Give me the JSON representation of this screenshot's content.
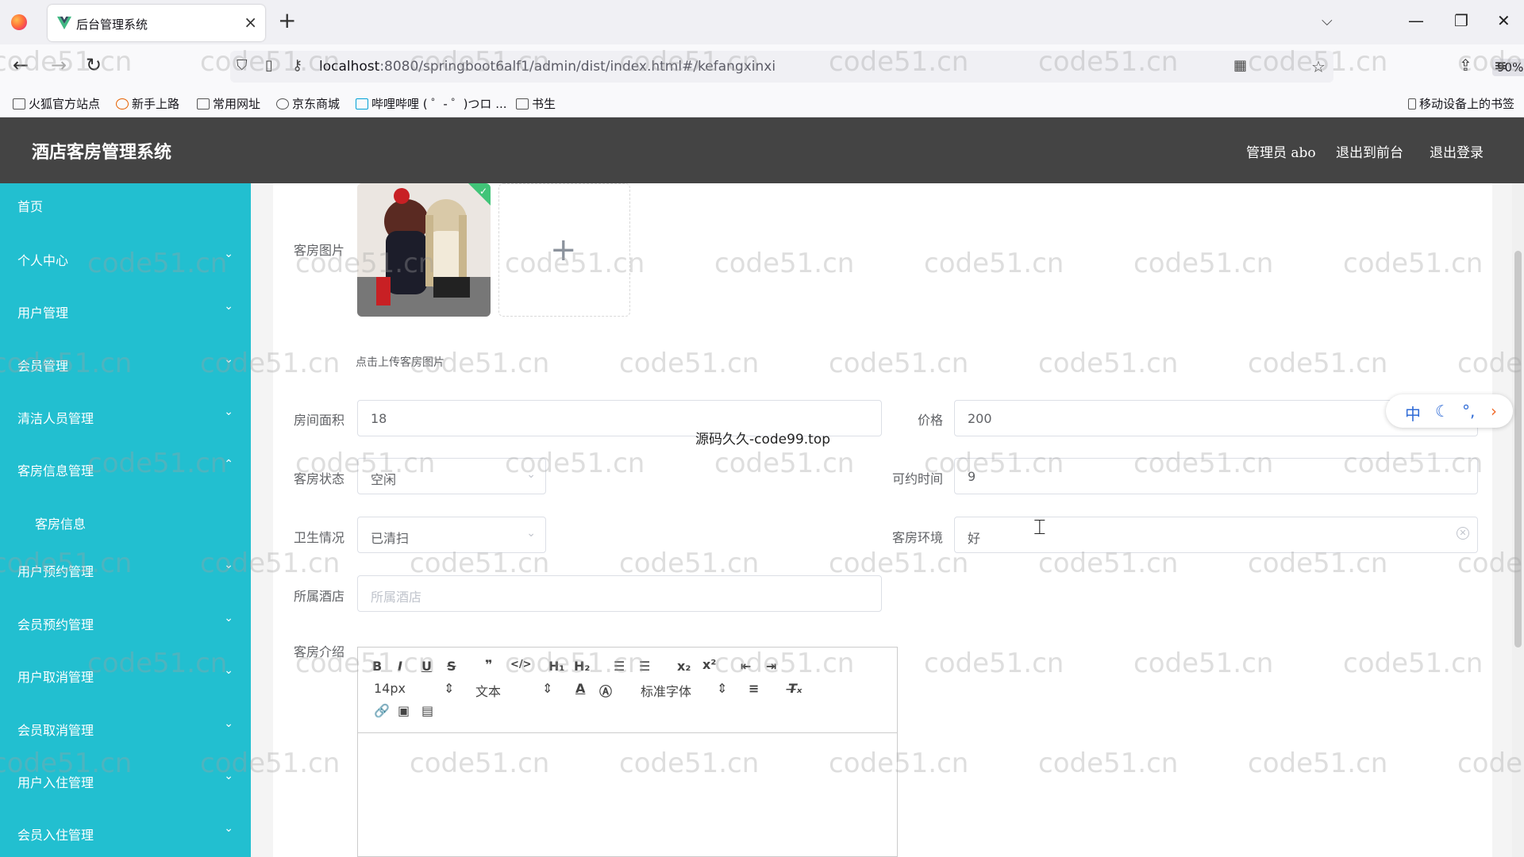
{
  "browser": {
    "tab_title": "后台管理系统",
    "url_host": "localhost",
    "url_rest": ":8080/springboot6alf1/admin/dist/index.html#/kefangxinxi",
    "zoom": "90%",
    "bookmarks": [
      "火狐官方站点",
      "新手上路",
      "常用网址",
      "京东商城",
      "哔哩哔哩 ( ゜- ゜)つロ ...",
      "书生"
    ],
    "mobile_bookmarks": "移动设备上的书签"
  },
  "header": {
    "title": "酒店客房管理系统",
    "user": "管理员 abo",
    "to_front": "退出到前台",
    "logout": "退出登录"
  },
  "sidebar": {
    "items": [
      {
        "label": "首页",
        "expandable": false
      },
      {
        "label": "个人中心",
        "expandable": true
      },
      {
        "label": "用户管理",
        "expandable": true
      },
      {
        "label": "会员管理",
        "expandable": true
      },
      {
        "label": "清洁人员管理",
        "expandable": true
      },
      {
        "label": "客房信息管理",
        "expandable": true,
        "open": true
      },
      {
        "label": "客房信息",
        "sub": true
      },
      {
        "label": "用户预约管理",
        "expandable": true
      },
      {
        "label": "会员预约管理",
        "expandable": true
      },
      {
        "label": "用户取消管理",
        "expandable": true
      },
      {
        "label": "会员取消管理",
        "expandable": true
      },
      {
        "label": "用户入住管理",
        "expandable": true
      },
      {
        "label": "会员入住管理",
        "expandable": true
      }
    ]
  },
  "form": {
    "image_label": "客房图片",
    "upload_tip": "点击上传客房图片",
    "area_label": "房间面积",
    "area_value": "18",
    "price_label": "价格",
    "price_value": "200",
    "status_label": "客房状态",
    "status_value": "空闲",
    "time_label": "可约时间",
    "time_value": "9",
    "hygiene_label": "卫生情况",
    "hygiene_value": "已清扫",
    "env_label": "客房环境",
    "env_value": "好",
    "hotel_label": "所属酒店",
    "hotel_placeholder": "所属酒店",
    "intro_label": "客房介绍"
  },
  "editor": {
    "font_size": "14px",
    "text_type": "文本",
    "font_family": "标准字体"
  },
  "overlay": {
    "center_text": "源码久久-code99.top",
    "watermark": "code51.cn",
    "ime_lang": "中"
  }
}
